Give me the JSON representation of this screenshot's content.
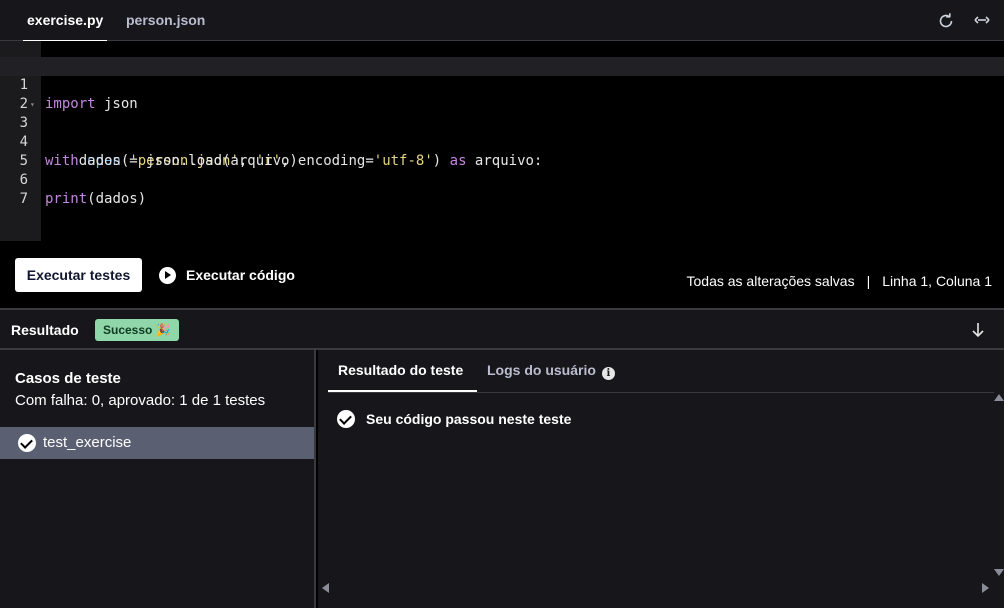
{
  "tabs": [
    {
      "label": "exercise.py",
      "active": true
    },
    {
      "label": "person.json",
      "active": false
    }
  ],
  "toolbar_icons": [
    "reset-icon",
    "expand-icon"
  ],
  "editor": {
    "lines": [
      {
        "number": "1",
        "text": "import json"
      },
      {
        "number": "2",
        "text": ""
      },
      {
        "number": "3",
        "text": "with open('person.json', 'r', encoding='utf-8') as arquivo:"
      },
      {
        "number": "4",
        "text": "    dados = json.load(arquivo)"
      },
      {
        "number": "5",
        "text": ""
      },
      {
        "number": "6",
        "text": "print(dados)"
      },
      {
        "number": "7",
        "text": ""
      }
    ]
  },
  "actions": {
    "run_tests_label": "Executar testes",
    "run_code_label": "Executar código",
    "saved_status": "Todas as alterações salvas",
    "separator": "|",
    "cursor_position": "Linha 1, Coluna 1"
  },
  "result": {
    "title": "Resultado",
    "badge": "Sucesso 🎉",
    "colors": {
      "badge_bg": "#8fd6a9",
      "badge_text": "#0f3a22"
    }
  },
  "test_cases": {
    "title": "Casos de teste",
    "summary": "Com falha: 0, aprovado: 1 de 1 testes",
    "items": [
      {
        "label": "test_exercise",
        "status": "passed"
      }
    ]
  },
  "result_tabs": [
    {
      "label": "Resultado do teste",
      "active": true
    },
    {
      "label": "Logs do usuário",
      "active": false
    }
  ],
  "test_result": {
    "message": "Seu código passou neste teste"
  }
}
